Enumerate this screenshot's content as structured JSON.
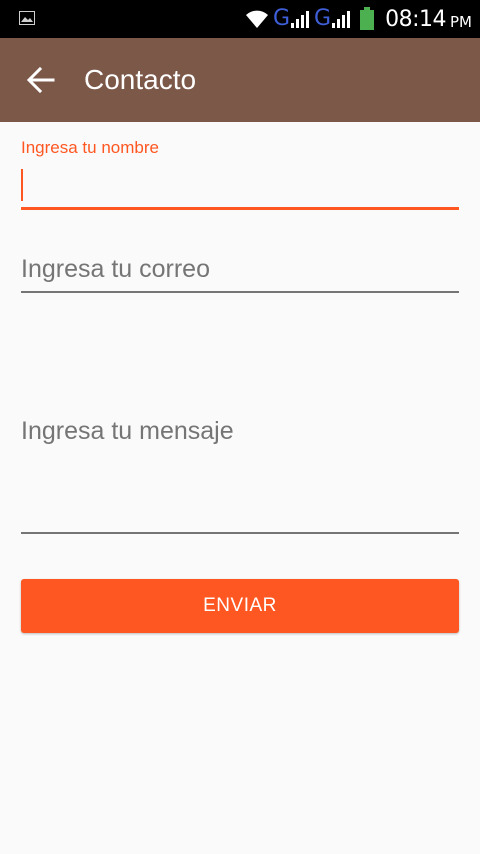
{
  "status_bar": {
    "network_1": "G",
    "network_2": "G",
    "time": "08:14",
    "ampm": "PM",
    "icons": [
      "gallery-icon",
      "wifi-icon",
      "signal-icon",
      "signal-icon",
      "battery-icon"
    ]
  },
  "app_bar": {
    "title": "Contacto",
    "back_icon": "arrow-left-icon"
  },
  "form": {
    "name": {
      "label": "Ingresa tu nombre",
      "value": ""
    },
    "email": {
      "placeholder": "Ingresa tu correo",
      "value": ""
    },
    "message": {
      "placeholder": "Ingresa tu mensaje",
      "value": ""
    },
    "submit_label": "ENVIAR"
  },
  "colors": {
    "app_bar": "#7b5848",
    "accent": "#ff5722",
    "background": "#fafafa",
    "underline_inactive": "#757575",
    "placeholder_text": "#757575"
  }
}
